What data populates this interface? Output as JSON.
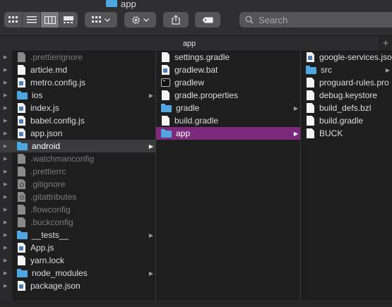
{
  "window": {
    "title": "app"
  },
  "toolbar": {
    "view_buttons": [
      {
        "name": "icon-view-button",
        "icon": "grid-icon"
      },
      {
        "name": "list-view-button",
        "icon": "list-icon"
      },
      {
        "name": "column-view-button",
        "icon": "columns-icon"
      },
      {
        "name": "gallery-view-button",
        "icon": "gallery-icon"
      }
    ],
    "active_view": "column-view-button",
    "search": {
      "placeholder": "Search",
      "value": ""
    }
  },
  "tab": {
    "label": "app"
  },
  "columns": [
    {
      "name": "column-1",
      "items": [
        {
          "label": ".prettierignore",
          "icon": "doc",
          "hidden": true
        },
        {
          "label": "article.md",
          "icon": "doc",
          "hidden": false
        },
        {
          "label": "metro.config.js",
          "icon": "code",
          "hidden": false
        },
        {
          "label": "ios",
          "icon": "folder",
          "hidden": false,
          "folder": true
        },
        {
          "label": "index.js",
          "icon": "code",
          "hidden": false
        },
        {
          "label": "babel.config.js",
          "icon": "code",
          "hidden": false
        },
        {
          "label": "app.json",
          "icon": "code",
          "hidden": false
        },
        {
          "label": "android",
          "icon": "folder",
          "hidden": false,
          "folder": true,
          "selected": true,
          "active": false
        },
        {
          "label": ".watchmanconfig",
          "icon": "doc",
          "hidden": true
        },
        {
          "label": ".prettierrc",
          "icon": "doc",
          "hidden": true
        },
        {
          "label": ".gitignore",
          "icon": "gear",
          "hidden": true
        },
        {
          "label": ".gitattributes",
          "icon": "gear",
          "hidden": true
        },
        {
          "label": ".flowconfig",
          "icon": "doc",
          "hidden": true
        },
        {
          "label": ".buckconfig",
          "icon": "doc",
          "hidden": true
        },
        {
          "label": "__tests__",
          "icon": "folder",
          "hidden": false,
          "folder": true
        },
        {
          "label": "App.js",
          "icon": "code",
          "hidden": false
        },
        {
          "label": "yarn.lock",
          "icon": "doc",
          "hidden": false
        },
        {
          "label": "node_modules",
          "icon": "folder",
          "hidden": false,
          "folder": true
        },
        {
          "label": "package.json",
          "icon": "code",
          "hidden": false
        }
      ]
    },
    {
      "name": "column-2",
      "items": [
        {
          "label": "settings.gradle",
          "icon": "doc",
          "hidden": false
        },
        {
          "label": "gradlew.bat",
          "icon": "code",
          "hidden": false
        },
        {
          "label": "gradlew",
          "icon": "bin",
          "hidden": false
        },
        {
          "label": "gradle.properties",
          "icon": "doc",
          "hidden": false
        },
        {
          "label": "gradle",
          "icon": "folder",
          "hidden": false,
          "folder": true
        },
        {
          "label": "build.gradle",
          "icon": "doc",
          "hidden": false
        },
        {
          "label": "app",
          "icon": "folder",
          "hidden": false,
          "folder": true,
          "selected": true,
          "active": true
        }
      ]
    },
    {
      "name": "column-3",
      "items": [
        {
          "label": "google-services.json",
          "icon": "code",
          "hidden": false
        },
        {
          "label": "src",
          "icon": "folder",
          "hidden": false,
          "folder": true
        },
        {
          "label": "proguard-rules.pro",
          "icon": "doc",
          "hidden": false
        },
        {
          "label": "debug.keystore",
          "icon": "doc",
          "hidden": false
        },
        {
          "label": "build_defs.bzl",
          "icon": "doc",
          "hidden": false
        },
        {
          "label": "build.gradle",
          "icon": "doc",
          "hidden": false
        },
        {
          "label": "BUCK",
          "icon": "doc",
          "hidden": false
        }
      ]
    }
  ],
  "colors": {
    "selection_active": "#7d2a7d",
    "folder": "#4ea7e0",
    "background": "#1e1e1e"
  }
}
